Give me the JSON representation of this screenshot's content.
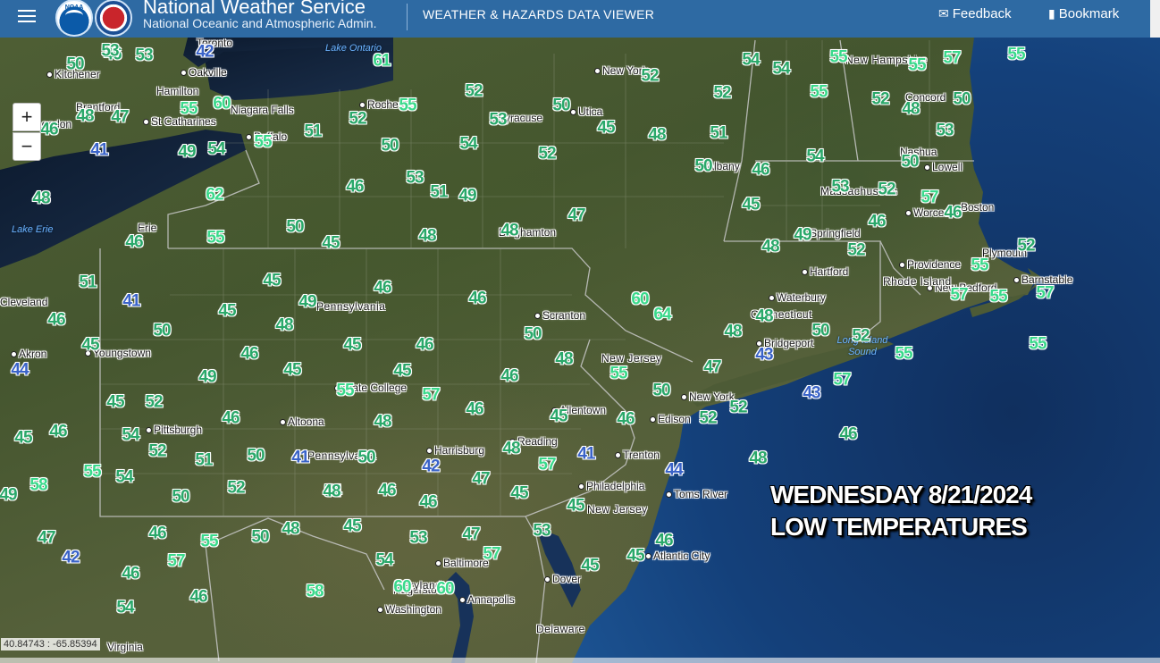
{
  "header": {
    "title": "National Weather Service",
    "subtitle": "National Oceanic and Atmospheric Admin.",
    "viewer": "WEATHER & HAZARDS DATA VIEWER",
    "feedback": "Feedback",
    "bookmark": "Bookmark",
    "noaa_logo_text": "NOAA"
  },
  "zoom": {
    "in": "+",
    "out": "−"
  },
  "overlay": {
    "line1": "WEDNESDAY 8/21/2024",
    "line2": "LOW TEMPERATURES"
  },
  "coordinates": "40.84743 : -65.85394",
  "water_labels": [
    "Lake Ontario",
    "Lake Erie",
    "Long Island Sound"
  ],
  "states": [
    "New Hampshire",
    "Massachusetts",
    "Rhode Island",
    "Connecticut",
    "Pennsylvania",
    "Pennsylvania",
    "New Jersey",
    "New Jersey",
    "Maryland",
    "Delaware"
  ],
  "cities": [
    "Toronto",
    "Kitchener",
    "Oakville",
    "Hamilton",
    "Brantford",
    "St Catharines",
    "London",
    "Niagara Falls",
    "Buffalo",
    "Rochester",
    "Syracuse",
    "Utica",
    "New York",
    "Albany",
    "Concord",
    "Nashua",
    "Lowell",
    "Boston",
    "Worcester",
    "Springfield",
    "Hartford",
    "Providence",
    "Plymouth",
    "Barnstable",
    "New Bedford",
    "Waterbury",
    "Bridgeport",
    "Erie",
    "Cleveland",
    "Akron",
    "Youngstown",
    "Pittsburgh",
    "Altoona",
    "State College",
    "Scranton",
    "Binghamton",
    "Allentown",
    "Edison",
    "New York",
    "Trenton",
    "Reading",
    "Harrisburg",
    "Philadelphia",
    "Toms River",
    "Atlantic City",
    "Baltimore",
    "Annapolis",
    "Washington",
    "Dover",
    "Hagerstown",
    "Virginia"
  ],
  "temperatures": [
    "46",
    "53",
    "42",
    "50",
    "53",
    "61",
    "60",
    "55",
    "48",
    "47",
    "46",
    "55",
    "41",
    "49",
    "54",
    "51",
    "52",
    "55",
    "50",
    "52",
    "54",
    "52",
    "50",
    "45",
    "48",
    "53",
    "51",
    "49",
    "46",
    "48",
    "62",
    "55",
    "50",
    "45",
    "48",
    "48",
    "47",
    "54",
    "54",
    "55",
    "55",
    "57",
    "55",
    "52",
    "52",
    "51",
    "55",
    "52",
    "48",
    "50",
    "53",
    "54",
    "50",
    "46",
    "53",
    "52",
    "57",
    "46",
    "45",
    "48",
    "49",
    "52",
    "46",
    "52",
    "55",
    "50",
    "53",
    "55",
    "57",
    "57",
    "55",
    "55",
    "52",
    "50",
    "57",
    "48",
    "48",
    "43",
    "43",
    "46",
    "51",
    "41",
    "45",
    "49",
    "46",
    "46",
    "45",
    "48",
    "46",
    "50",
    "45",
    "45",
    "46",
    "44",
    "46",
    "50",
    "45",
    "46",
    "48",
    "45",
    "49",
    "55",
    "57",
    "46",
    "55",
    "50",
    "60",
    "64",
    "47",
    "52",
    "46",
    "48",
    "45",
    "52",
    "46",
    "45",
    "46",
    "48",
    "54",
    "52",
    "51",
    "50",
    "41",
    "50",
    "42",
    "48",
    "45",
    "46",
    "41",
    "57",
    "52",
    "44",
    "47",
    "46",
    "46",
    "45",
    "52",
    "54",
    "49",
    "55",
    "54",
    "58",
    "50",
    "48",
    "45",
    "45",
    "47",
    "42",
    "46",
    "55",
    "50",
    "48",
    "53",
    "47",
    "57",
    "53",
    "46",
    "45",
    "45",
    "57",
    "46",
    "46",
    "54",
    "58",
    "54",
    "60",
    "60"
  ],
  "colors": {
    "header": "#2e6aa3",
    "temp_green": "#2fd07a",
    "temp_blue": "#3a63c8",
    "ocean": "#12386a"
  }
}
